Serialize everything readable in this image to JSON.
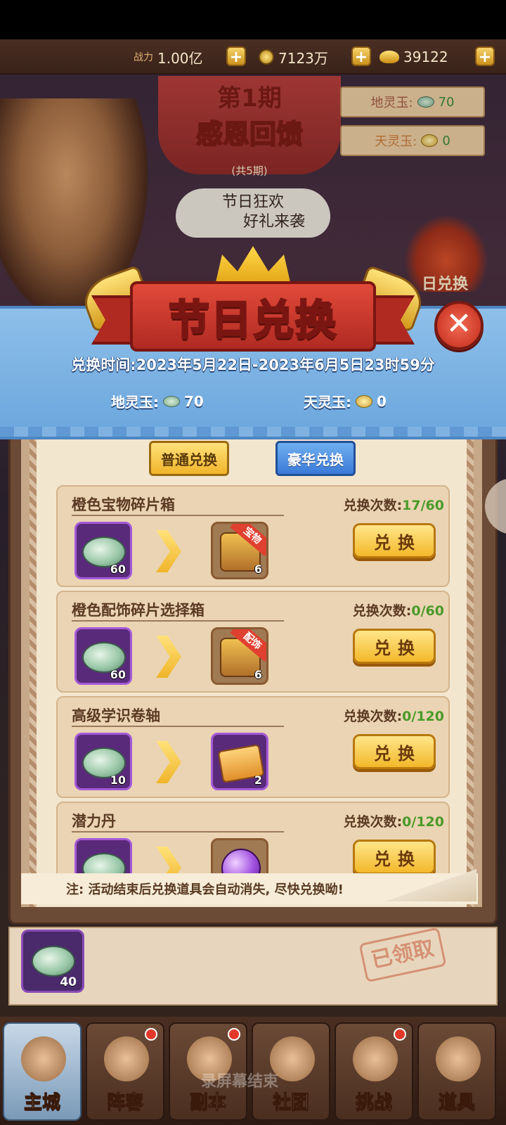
{
  "resources": {
    "power_label": "战力",
    "power_value": "1.00亿",
    "coins_value": "7123万",
    "ingots_value": "39122"
  },
  "background": {
    "period": "第1期",
    "event_title": "感恩回馈",
    "period_total": "(共5期)",
    "slogan_line1": "节日狂欢",
    "slogan_line2": "好礼来袭",
    "earth_jade_label": "地灵玉:",
    "earth_jade_value": "70",
    "heaven_jade_label": "天灵玉:",
    "heaven_jade_value": "0",
    "gift_label": "日兑换"
  },
  "modal": {
    "title": "节日兑换",
    "time": "兑换时间:2023年5月22日-2023年6月5日23时59分",
    "earth_jade_label": "地灵玉:",
    "earth_jade_value": "70",
    "heaven_jade_label": "天灵玉:",
    "heaven_jade_value": "0",
    "close_symbol": "✕",
    "tabs": {
      "normal": "普通兑换",
      "luxury": "豪华兑换"
    },
    "exchange_button": "兑换",
    "count_label": "兑换次数:",
    "items": [
      {
        "name": "橙色宝物碎片箱",
        "count": "17/60",
        "cost": "60",
        "reward_qty": "6",
        "tag": "宝物"
      },
      {
        "name": "橙色配饰碎片选择箱",
        "count": "0/60",
        "cost": "60",
        "reward_qty": "6",
        "tag": "配饰"
      },
      {
        "name": "高级学识卷轴",
        "count": "0/120",
        "cost": "10",
        "reward_qty": "2",
        "tag": ""
      },
      {
        "name": "潜力丹",
        "count": "0/120",
        "cost": "",
        "reward_qty": "",
        "tag": ""
      }
    ],
    "note": "注: 活动结束后兑换道具会自动消失, 尽快兑换呦!"
  },
  "claim": {
    "qty": "40",
    "status": "已领取"
  },
  "nav": {
    "items": [
      {
        "label": "主城"
      },
      {
        "label": "阵容"
      },
      {
        "label": "副本"
      },
      {
        "label": "社团"
      },
      {
        "label": "挑战"
      },
      {
        "label": "道具"
      }
    ],
    "watermark": "录屏幕结束"
  },
  "colors": {
    "accent_gold": "#f3b82a",
    "count_green": "#4a9a2a",
    "close_red": "#c02a1a",
    "header_blue": "#6aa6dd"
  }
}
